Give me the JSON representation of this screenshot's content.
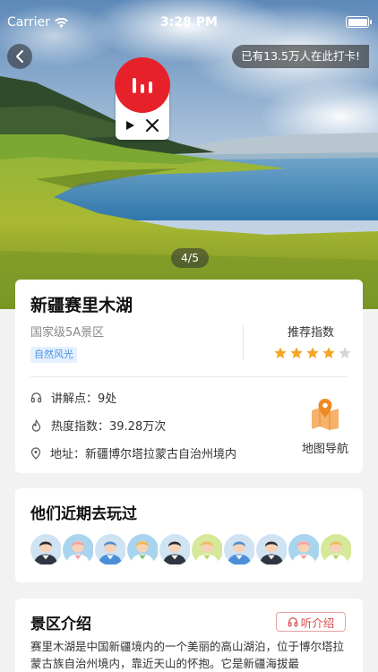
{
  "status_bar": {
    "carrier": "Carrier",
    "time": "3:28 PM"
  },
  "hero": {
    "checkin_text": "已有13.5万人在此打卡!",
    "photo_counter": "4/5"
  },
  "info": {
    "title": "新疆赛里木湖",
    "level": "国家级5A景区",
    "tag": "自然风光",
    "recommend_label": "推荐指数",
    "rating": 4,
    "rating_max": 5,
    "commentary_points": "讲解点：9处",
    "popularity": "热度指数：39.28万次",
    "address": "地址：新疆博尔塔拉蒙古自治州境内",
    "map_nav_label": "地图导航"
  },
  "recent": {
    "title": "他们近期去玩过",
    "avatars": [
      {
        "icon": "avatar-man-suit"
      },
      {
        "icon": "avatar-woman-pink"
      },
      {
        "icon": "avatar-woman-blue"
      },
      {
        "icon": "avatar-man-bowtie"
      },
      {
        "icon": "avatar-man-suit"
      },
      {
        "icon": "avatar-woman-green"
      },
      {
        "icon": "avatar-woman-blue"
      },
      {
        "icon": "avatar-man-suit"
      },
      {
        "icon": "avatar-woman-pink"
      },
      {
        "icon": "avatar-woman-green"
      }
    ]
  },
  "intro": {
    "title": "景区介绍",
    "listen_label": "听介绍",
    "text": "赛里木湖是中国新疆境内的一个美丽的高山湖泊，位于博尔塔拉蒙古族自治州境内，靠近天山的怀抱。它是新疆海拔最"
  },
  "colors": {
    "accent_red": "#e6212a",
    "star": "#f5a623",
    "tag_blue": "#4a92e6",
    "map_orange": "#f08a24"
  }
}
